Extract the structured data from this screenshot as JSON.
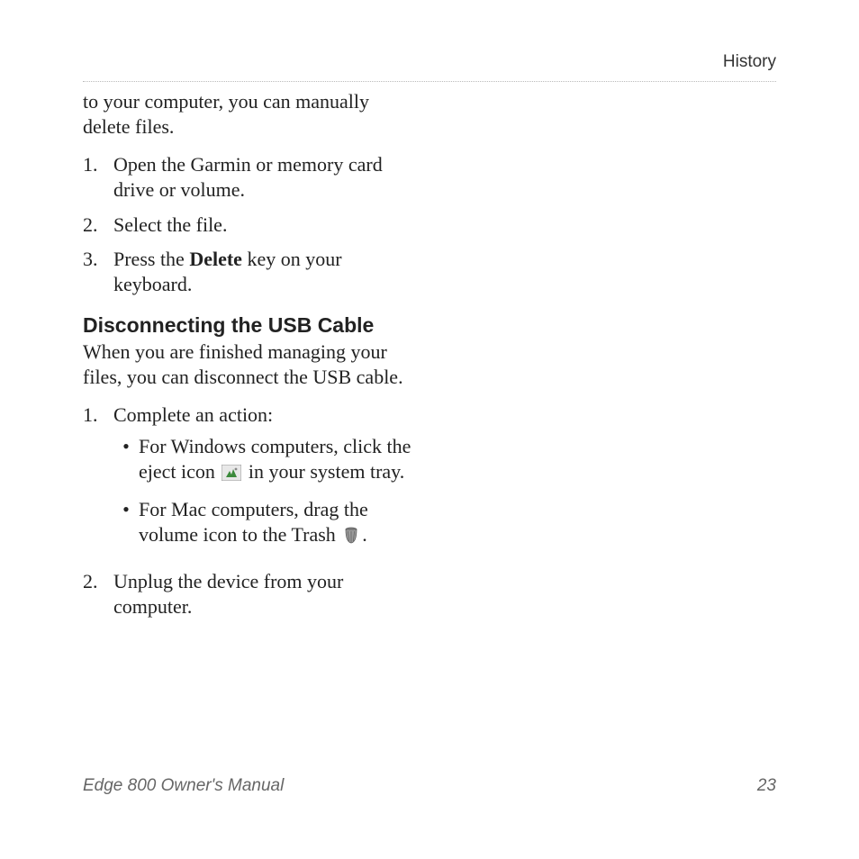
{
  "header": {
    "section": "History"
  },
  "intro": {
    "line1": "to your computer, you can manually",
    "line2": "delete files."
  },
  "steps1": {
    "s1": {
      "num": "1.",
      "text": "Open the Garmin or memory card drive or volume."
    },
    "s2": {
      "num": "2.",
      "text": "Select the file."
    },
    "s3": {
      "num": "3.",
      "pre": "Press the ",
      "bold": "Delete",
      "post": " key on your keyboard."
    }
  },
  "subhead": "Disconnecting the USB Cable",
  "usb_intro": "When you are finished managing your files, you can disconnect the USB cable.",
  "steps2": {
    "s1": {
      "num": "1.",
      "text": "Complete an action:",
      "sub": {
        "a_pre": "For Windows computers, click the eject icon ",
        "a_post": " in your system tray.",
        "b_pre": "For Mac computers, drag the volume icon to the Trash ",
        "b_post": "."
      }
    },
    "s2": {
      "num": "2.",
      "text": "Unplug the device from your computer."
    }
  },
  "icons": {
    "eject": "eject-icon",
    "trash": "trash-icon"
  },
  "footer": {
    "title": "Edge 800 Owner's Manual",
    "page": "23"
  }
}
